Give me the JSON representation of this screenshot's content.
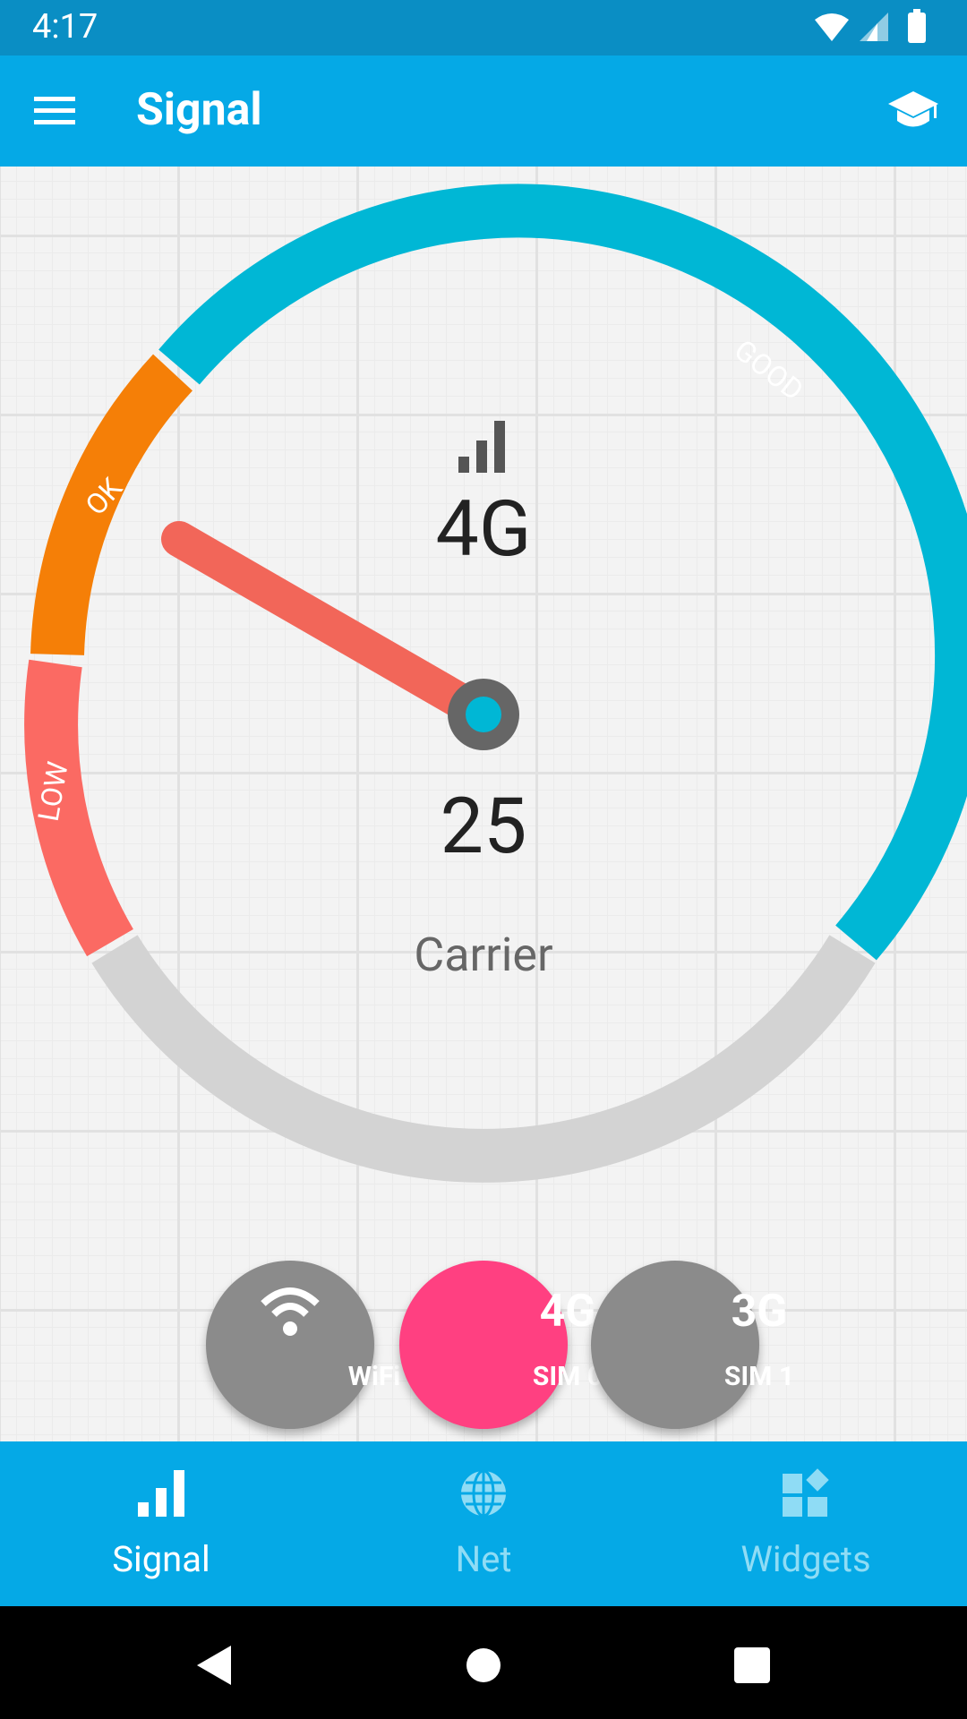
{
  "status_bar": {
    "time": "4:17"
  },
  "app_bar": {
    "title": "Signal"
  },
  "gauge": {
    "network_type": "4G",
    "value": 25,
    "carrier": "Carrier",
    "zones": [
      {
        "label": "LOW",
        "color": "#fb6a63"
      },
      {
        "label": "OK",
        "color": "#f57f07"
      },
      {
        "label": "GOOD",
        "color": "#00b7d5"
      }
    ],
    "track_color": "#d3d3d3",
    "needle_color": "#f26659"
  },
  "sim_buttons": [
    {
      "top": "",
      "bottom": "WiFi",
      "icon": "wifi-icon",
      "active": false
    },
    {
      "top": "4G",
      "bottom": "SIM 0",
      "active": true
    },
    {
      "top": "3G",
      "bottom": "SIM 1",
      "active": false
    }
  ],
  "bottom_nav": {
    "items": [
      {
        "label": "Signal",
        "icon": "signal-bars-icon",
        "active": true
      },
      {
        "label": "Net",
        "icon": "globe-icon",
        "active": false
      },
      {
        "label": "Widgets",
        "icon": "widgets-icon",
        "active": false
      }
    ]
  },
  "colors": {
    "status_bar": "#0a8ec4",
    "app_bar": "#05a9e6",
    "accent": "#ff4081",
    "fab_inactive": "#8b8b8b"
  }
}
